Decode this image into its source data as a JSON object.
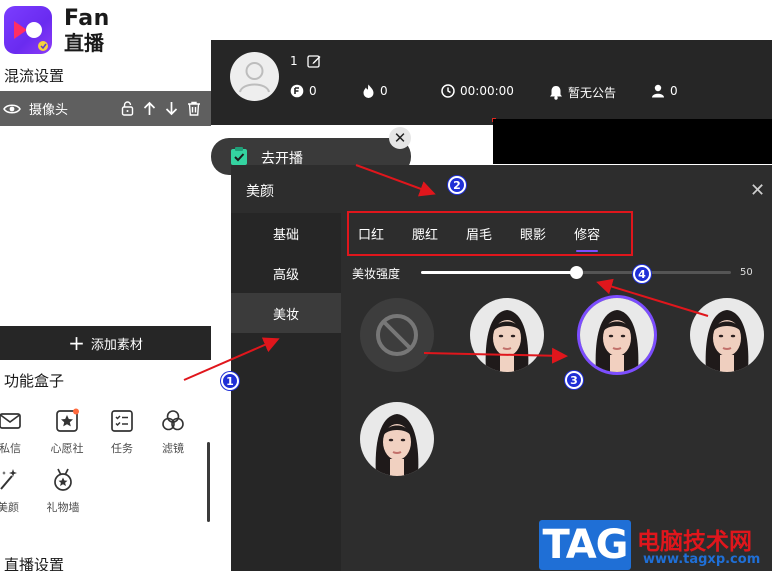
{
  "app": {
    "logo_line1": "Fan",
    "logo_line2": "直播"
  },
  "left": {
    "mix_title": "混流设置",
    "source_row": {
      "label": "摄像头"
    },
    "add_material": "添加素材",
    "toolbox_title": "功能盒子",
    "toolbox_items": [
      {
        "label": "私信",
        "icon": "mail-icon"
      },
      {
        "label": "心愿社",
        "icon": "wish-star-icon"
      },
      {
        "label": "任务",
        "icon": "task-list-icon"
      },
      {
        "label": "滤镜",
        "icon": "filter-circles-icon"
      },
      {
        "label": "美颜",
        "icon": "magic-wand-icon"
      },
      {
        "label": "礼物墙",
        "icon": "medal-icon"
      }
    ],
    "live_settings_title": "直播设置"
  },
  "topbar": {
    "user_number": "1",
    "coins": "0",
    "heat": "0",
    "duration": "00:00:00",
    "notice": "暂无公告",
    "viewers": "0"
  },
  "go_live": {
    "label": "去开播"
  },
  "beauty": {
    "title": "美颜",
    "categories": [
      "基础",
      "高级",
      "美妆"
    ],
    "active_category": "美妆",
    "tabs": [
      "口红",
      "腮红",
      "眉毛",
      "眼影",
      "修容"
    ],
    "active_tab": "修容",
    "strength_label": "美妆强度",
    "strength_value": 50,
    "strength_fraction": 0.5,
    "presets": [
      "none",
      "face-1",
      "face-2",
      "face-3",
      "face-4"
    ],
    "selected_preset": "face-2"
  },
  "annotations": [
    "1",
    "2",
    "3",
    "4"
  ],
  "watermark": {
    "logo": "TAG",
    "site_name": "电脑技术网",
    "url": "www.tagxp.com"
  },
  "colors": {
    "accent": "#7c4dff",
    "highlight": "#e0161c",
    "badge": "#1f2fd6",
    "panel": "#2d2d2d"
  }
}
